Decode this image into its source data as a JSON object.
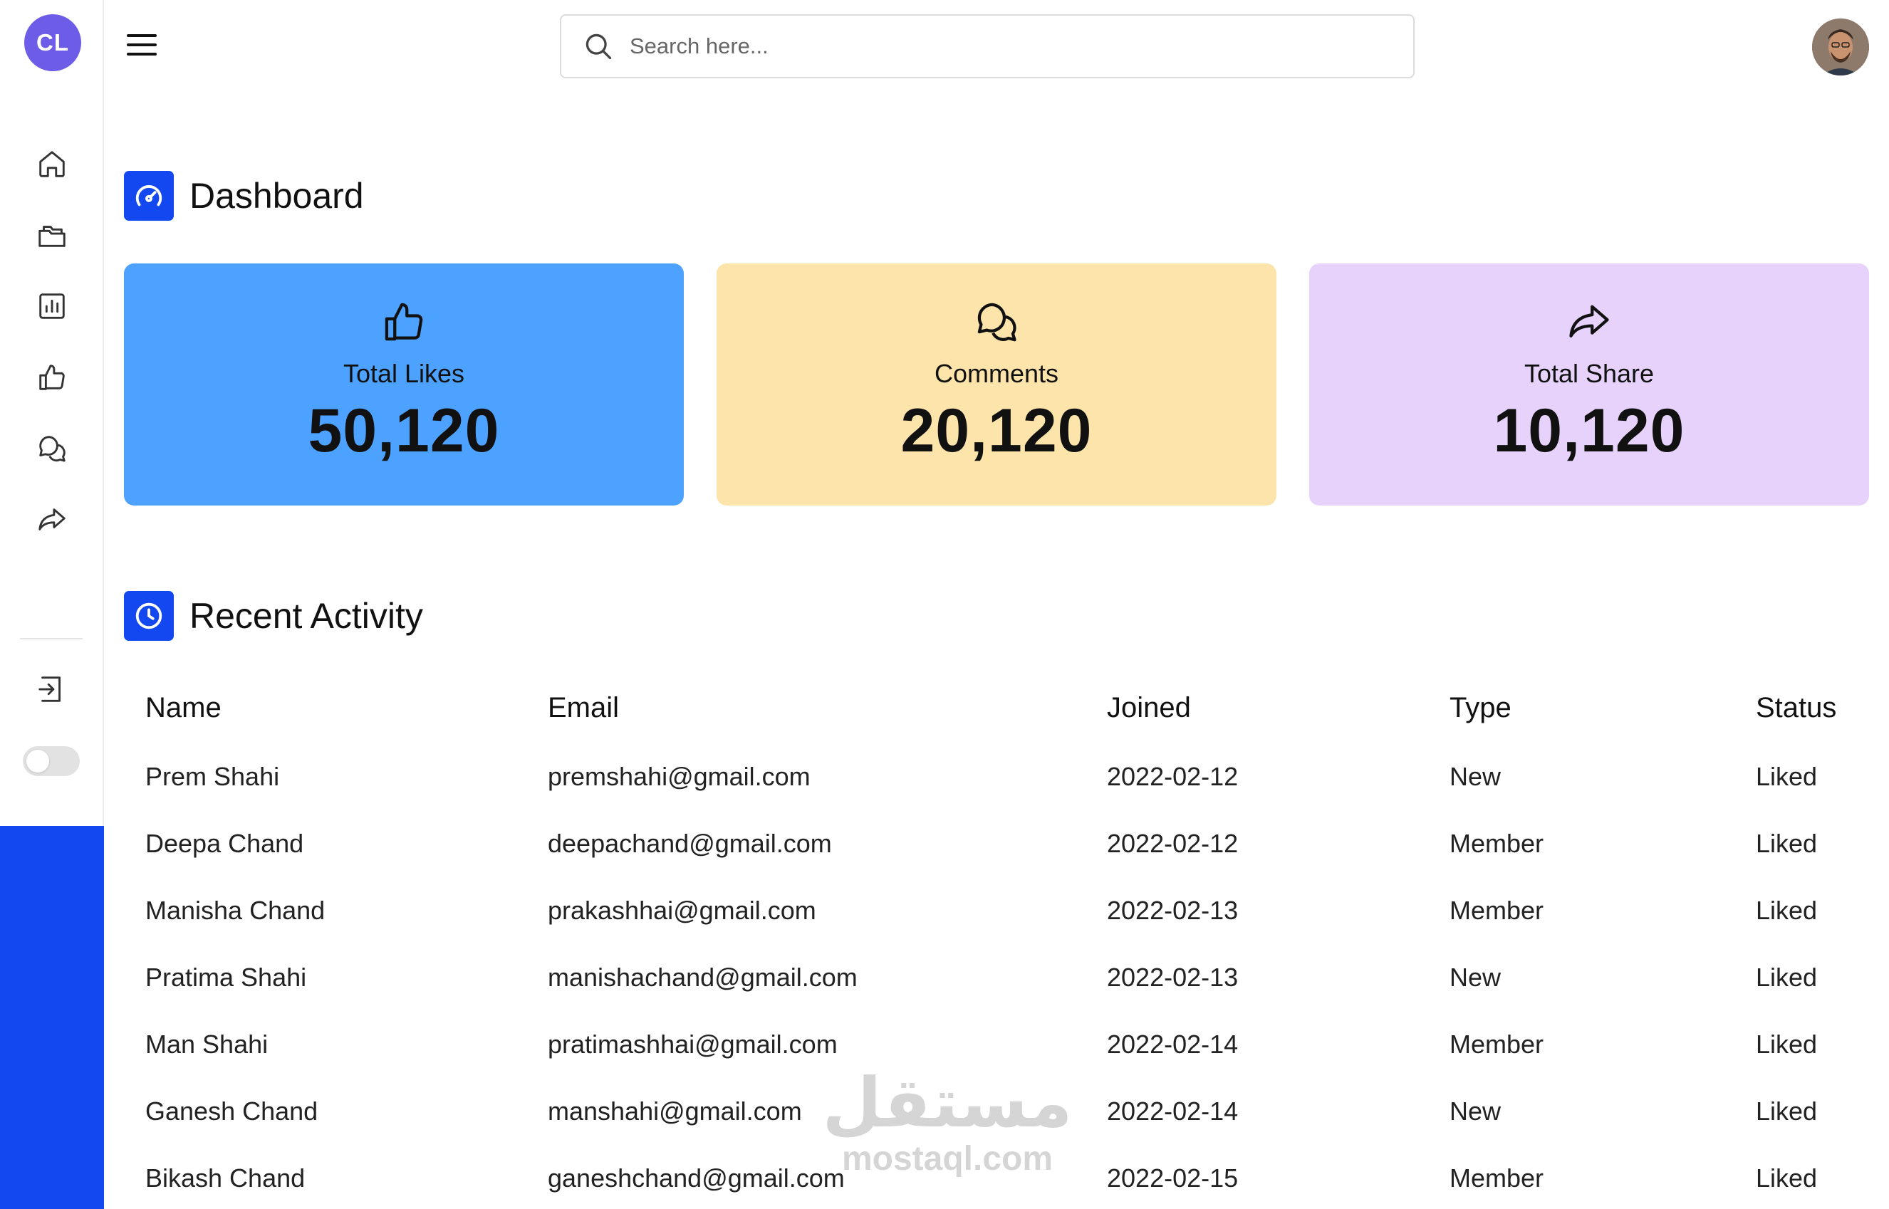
{
  "app": {
    "logo_text": "CL",
    "accent_color": "#1347f0",
    "logo_color": "#6d5ce8"
  },
  "sidebar": {
    "items": [
      {
        "icon": "home-icon"
      },
      {
        "icon": "folders-icon"
      },
      {
        "icon": "bar-chart-icon"
      },
      {
        "icon": "thumbs-up-icon"
      },
      {
        "icon": "comments-icon"
      },
      {
        "icon": "share-icon"
      }
    ],
    "logout_icon": "logout-icon",
    "theme_toggle": "off"
  },
  "header": {
    "search": {
      "placeholder": "Search here..."
    },
    "menu_icon": "hamburger-menu-icon",
    "avatar_icon": "user-avatar"
  },
  "dashboard": {
    "title": "Dashboard",
    "cards": [
      {
        "label": "Total Likes",
        "value": "50,120",
        "icon": "thumbs-up-icon",
        "color": "#4da2ff"
      },
      {
        "label": "Comments",
        "value": "20,120",
        "icon": "comments-icon",
        "color": "#fde4ab"
      },
      {
        "label": "Total Share",
        "value": "10,120",
        "icon": "share-icon",
        "color": "#e6d2fb"
      }
    ]
  },
  "activity": {
    "title": "Recent Activity",
    "columns": [
      "Name",
      "Email",
      "Joined",
      "Type",
      "Status"
    ],
    "rows": [
      [
        "Prem Shahi",
        "premshahi@gmail.com",
        "2022-02-12",
        "New",
        "Liked"
      ],
      [
        "Deepa Chand",
        "deepachand@gmail.com",
        "2022-02-12",
        "Member",
        "Liked"
      ],
      [
        "Manisha Chand",
        "prakashhai@gmail.com",
        "2022-02-13",
        "Member",
        "Liked"
      ],
      [
        "Pratima Shahi",
        "manishachand@gmail.com",
        "2022-02-13",
        "New",
        "Liked"
      ],
      [
        "Man Shahi",
        "pratimashhai@gmail.com",
        "2022-02-14",
        "Member",
        "Liked"
      ],
      [
        "Ganesh Chand",
        "manshahi@gmail.com",
        "2022-02-14",
        "New",
        "Liked"
      ],
      [
        "Bikash Chand",
        "ganeshchand@gmail.com",
        "2022-02-15",
        "Member",
        "Liked"
      ]
    ]
  },
  "watermark": {
    "arabic": "مستقل",
    "latin": "mostaql.com"
  }
}
